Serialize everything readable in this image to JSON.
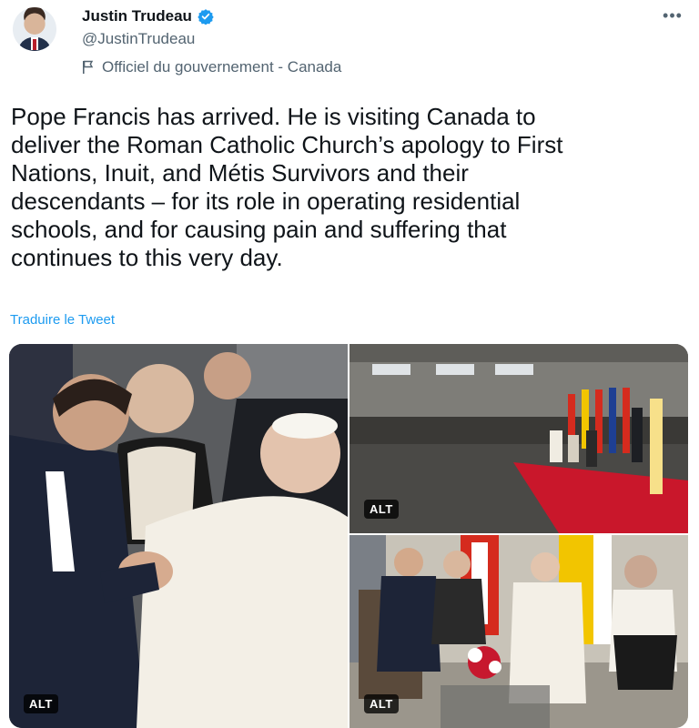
{
  "tweet": {
    "author": {
      "display_name": "Justin Trudeau",
      "handle": "@JustinTrudeau",
      "verified": true,
      "account_label": "Officiel du gouvernement - Canada",
      "label_icon": "flag-icon",
      "verified_icon": "verified-badge-icon",
      "verified_color": "#1d9bf0"
    },
    "more_icon": "more-options-icon",
    "more_label": "•••",
    "text": "Pope Francis has arrived. He is visiting Canada to\ndeliver the Roman Catholic Church’s apology to First\nNations, Inuit, and Métis Survivors and their\ndescendants – for its role in operating residential\nschools, and for causing pain and suffering that\ncontinues to this very day.",
    "translate_label": "Traduire le Tweet",
    "media": [
      {
        "alt_label": "ALT"
      },
      {
        "alt_label": "ALT"
      },
      {
        "alt_label": "ALT"
      }
    ]
  },
  "colors": {
    "text_primary": "#0f1419",
    "text_secondary": "#536471",
    "link": "#1d9bf0",
    "canada_red": "#d52b1e",
    "vatican_yellow": "#f2c500"
  }
}
